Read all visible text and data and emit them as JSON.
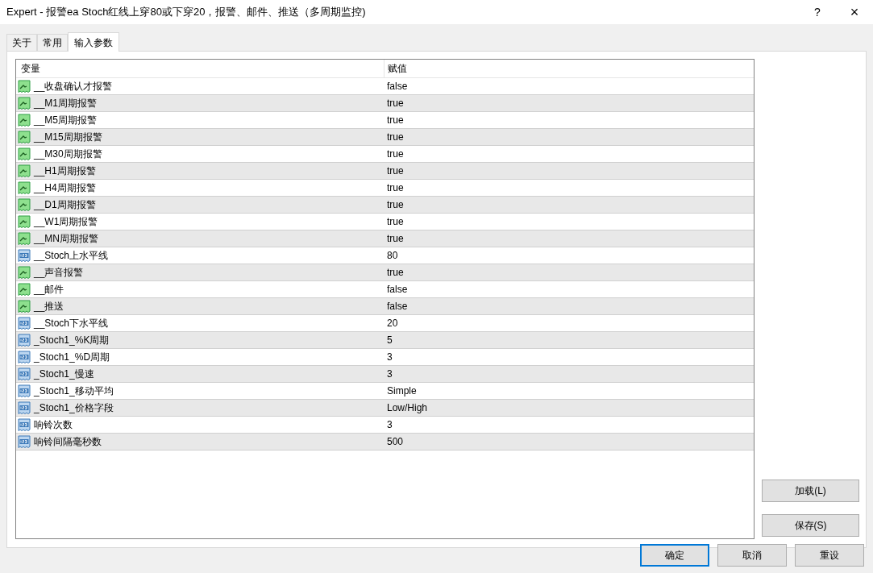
{
  "window": {
    "title": "Expert - 报警ea  Stoch红线上穿80或下穿20，报警、邮件、推送（多周期监控)",
    "controls": [
      "?",
      "×"
    ]
  },
  "tabs": [
    {
      "label": "关于",
      "selected": false
    },
    {
      "label": "常用",
      "selected": false
    },
    {
      "label": "输入参数",
      "selected": true
    }
  ],
  "table": {
    "columns": [
      "变量",
      "赋值"
    ],
    "rows": [
      {
        "kind": "bool",
        "name": "__收盘确认才报警",
        "value": "false"
      },
      {
        "kind": "bool",
        "name": "__M1周期报警",
        "value": "true"
      },
      {
        "kind": "bool",
        "name": "__M5周期报警",
        "value": "true"
      },
      {
        "kind": "bool",
        "name": "__M15周期报警",
        "value": "true"
      },
      {
        "kind": "bool",
        "name": "__M30周期报警",
        "value": "true"
      },
      {
        "kind": "bool",
        "name": "__H1周期报警",
        "value": "true"
      },
      {
        "kind": "bool",
        "name": "__H4周期报警",
        "value": "true"
      },
      {
        "kind": "bool",
        "name": "__D1周期报警",
        "value": "true"
      },
      {
        "kind": "bool",
        "name": "__W1周期报警",
        "value": "true"
      },
      {
        "kind": "bool",
        "name": "__MN周期报警",
        "value": "true"
      },
      {
        "kind": "number",
        "name": "__Stoch上水平线",
        "value": "80"
      },
      {
        "kind": "bool",
        "name": "__声音报警",
        "value": "true"
      },
      {
        "kind": "bool",
        "name": "__邮件",
        "value": "false"
      },
      {
        "kind": "bool",
        "name": "__推送",
        "value": "false"
      },
      {
        "kind": "number",
        "name": "__Stoch下水平线",
        "value": "20"
      },
      {
        "kind": "number",
        "name": "_Stoch1_%K周期",
        "value": "5"
      },
      {
        "kind": "number",
        "name": "_Stoch1_%D周期",
        "value": "3"
      },
      {
        "kind": "number",
        "name": "_Stoch1_慢速",
        "value": "3"
      },
      {
        "kind": "number",
        "name": "_Stoch1_移动平均",
        "value": "Simple"
      },
      {
        "kind": "number",
        "name": "_Stoch1_价格字段",
        "value": "Low/High"
      },
      {
        "kind": "number",
        "name": "响铃次数",
        "value": "3"
      },
      {
        "kind": "number",
        "name": "响铃间隔毫秒数",
        "value": "500"
      }
    ]
  },
  "side_buttons": [
    "加载(L)",
    "保存(S)"
  ],
  "buttons": [
    {
      "label": "确定",
      "selected": true
    },
    {
      "label": "取消",
      "selected": false
    },
    {
      "label": "重设",
      "selected": false
    }
  ]
}
